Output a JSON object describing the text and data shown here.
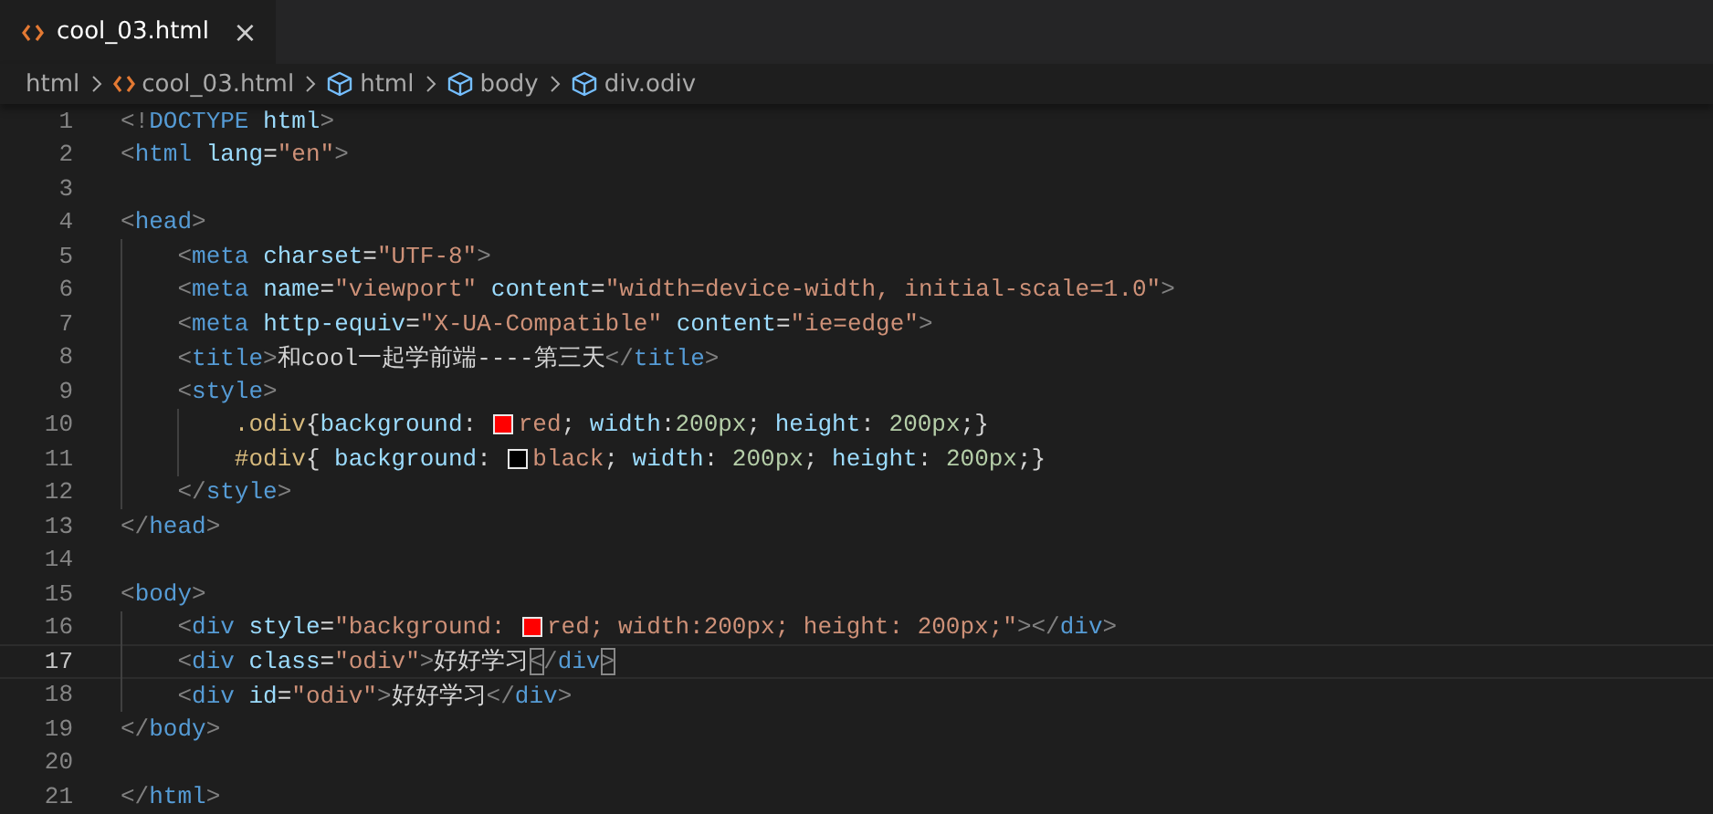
{
  "tabs": [
    {
      "label": "cool_03.html",
      "close": "×",
      "selected": true
    }
  ],
  "breadcrumb": [
    {
      "label": "html"
    },
    {
      "label": "cool_03.html"
    },
    {
      "label": "html"
    },
    {
      "label": "body"
    },
    {
      "label": "div.odiv"
    }
  ],
  "lines": [
    {
      "number": "1",
      "kind": "html",
      "current": false,
      "parts": [
        {
          "kind": "code",
          "text": "<!DOCTYPE html>"
        }
      ]
    },
    {
      "number": "2",
      "kind": "html",
      "current": false,
      "parts": [
        {
          "kind": "code",
          "text": "<html lang=\"en\">"
        }
      ]
    },
    {
      "number": "3",
      "kind": "html",
      "current": false
    },
    {
      "number": "4",
      "kind": "html",
      "current": false,
      "parts": [
        {
          "kind": "code",
          "text": "<head>"
        }
      ]
    },
    {
      "number": "5",
      "kind": "html",
      "current": false,
      "parts": [
        {
          "kind": "code",
          "text": "    <meta charset=\"UTF-8\">"
        }
      ]
    },
    {
      "number": "6",
      "kind": "html",
      "current": false,
      "parts": [
        {
          "kind": "code",
          "text": "    <meta name=\"viewport\" content=\"width=device-width, initial-scale=1.0\">"
        }
      ]
    },
    {
      "number": "7",
      "kind": "html",
      "current": false,
      "parts": [
        {
          "kind": "code",
          "text": "    <meta http-equiv=\"X-UA-Compatible\" content=\"ie=edge\">"
        }
      ]
    },
    {
      "number": "8",
      "kind": "html",
      "current": false,
      "parts": [
        {
          "kind": "code",
          "text": "    <title>和cool一起学前端----第三天</title>"
        }
      ]
    },
    {
      "number": "9",
      "kind": "html",
      "current": false,
      "parts": [
        {
          "kind": "code",
          "text": "    <style>"
        }
      ]
    },
    {
      "number": "10",
      "kind": "css",
      "current": false,
      "parts": [
        {
          "kind": "code",
          "text": "        .odiv{background: "
        },
        {
          "kind": "swatch",
          "color": "#ff0000"
        },
        {
          "kind": "code",
          "text": "red; width:200px; height: 200px;}"
        }
      ]
    },
    {
      "number": "11",
      "kind": "css",
      "current": false,
      "parts": [
        {
          "kind": "code",
          "text": "        #odiv{ background: "
        },
        {
          "kind": "swatch",
          "color": "#000000"
        },
        {
          "kind": "code",
          "text": "black; width: 200px; height: 200px;}"
        }
      ]
    },
    {
      "number": "12",
      "kind": "html",
      "current": false,
      "parts": [
        {
          "kind": "code",
          "text": "    </style>"
        }
      ]
    },
    {
      "number": "13",
      "kind": "html",
      "current": false,
      "parts": [
        {
          "kind": "code",
          "text": "</head>"
        }
      ]
    },
    {
      "number": "14",
      "kind": "html",
      "current": false
    },
    {
      "number": "15",
      "kind": "html",
      "current": false,
      "parts": [
        {
          "kind": "code",
          "text": "<body>"
        }
      ]
    },
    {
      "number": "16",
      "kind": "html",
      "current": false,
      "parts": [
        {
          "kind": "code",
          "text": "    <div style=\"background: "
        },
        {
          "kind": "swatch",
          "color": "#ff0000"
        },
        {
          "kind": "code",
          "text": "red; width:200px; height: 200px;\"></div>"
        }
      ]
    },
    {
      "number": "17",
      "kind": "html",
      "current": true,
      "parts": [
        {
          "kind": "code",
          "text": "    <div class=\"odiv\">好好学习</div>"
        }
      ]
    },
    {
      "number": "18",
      "kind": "html",
      "current": false,
      "parts": [
        {
          "kind": "code",
          "text": "    <div id=\"odiv\">好好学习</div>"
        }
      ]
    },
    {
      "number": "19",
      "kind": "html",
      "current": false,
      "parts": [
        {
          "kind": "code",
          "text": "</body>"
        }
      ]
    },
    {
      "number": "20",
      "kind": "html",
      "current": false
    },
    {
      "number": "21",
      "kind": "html",
      "current": false,
      "parts": [
        {
          "kind": "code",
          "text": "</html>"
        }
      ]
    }
  ]
}
